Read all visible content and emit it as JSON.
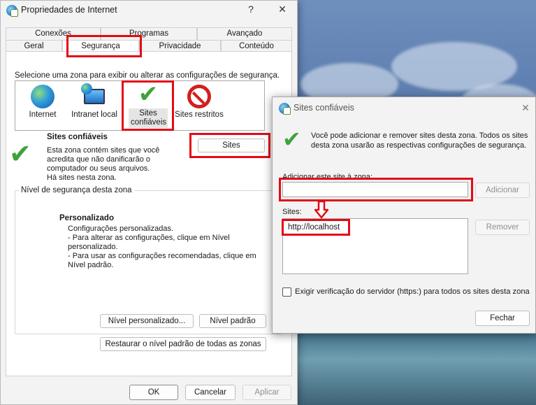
{
  "main_window": {
    "title": "Propriedades de Internet",
    "help_glyph": "?",
    "close_glyph": "✕",
    "tabs_row_back": [
      "Conexões",
      "Programas",
      "Avançado"
    ],
    "tabs_row_front": [
      "Geral",
      "Segurança",
      "Privacidade",
      "Conteúdo"
    ],
    "active_tab": "Segurança",
    "instruction": "Selecione uma zona para exibir ou alterar as configurações de segurança.",
    "zones": [
      {
        "label": "Internet",
        "icon": "globe-icon"
      },
      {
        "label": "Intranet local",
        "icon": "intranet-icon"
      },
      {
        "label": "Sites\nconfiáveis",
        "icon": "check-icon"
      },
      {
        "label": "Sites restritos",
        "icon": "no-entry-icon"
      }
    ],
    "selected_zone_title": "Sites confiáveis",
    "selected_zone_desc_1": "Esta zona contém sites que você",
    "selected_zone_desc_2": "acredita que não danificarão o",
    "selected_zone_desc_3": "computador ou seus arquivos.",
    "selected_zone_desc_4": "Há sites nesta zona.",
    "sites_button": "Sites",
    "security_level_legend": "Nível de segurança desta zona",
    "custom_title": "Personalizado",
    "custom_line_1": "Configurações personalizadas.",
    "custom_line_2": "- Para alterar as configurações, clique em Nível",
    "custom_line_3": "personalizado.",
    "custom_line_4": "- Para usar as configurações recomendadas, clique em",
    "custom_line_5": "Nível padrão.",
    "custom_level_button": "Nível personalizado...",
    "default_level_button": "Nível padrão",
    "restore_all_button": "Restaurar o nível padrão de todas as zonas",
    "ok_button": "OK",
    "cancel_button": "Cancelar",
    "apply_button": "Aplicar"
  },
  "trusted_window": {
    "title": "Sites confiáveis",
    "close_glyph": "✕",
    "info_1": "Você pode adicionar e remover sites desta zona. Todos os sites",
    "info_2": "desta zona usarão as respectivas configurações de segurança.",
    "add_label": "Adicionar este site à zona:",
    "add_input_value": "",
    "add_button": "Adicionar",
    "sites_label": "Sites:",
    "sites": [
      "http://localhost"
    ],
    "remove_button": "Remover",
    "require_https_label": "Exigir verificação do servidor (https:) para todos os sites desta zona",
    "require_https_checked": false,
    "close_button": "Fechar"
  },
  "colors": {
    "highlight_red": "#e30a17",
    "check_green": "#3fa33b"
  }
}
